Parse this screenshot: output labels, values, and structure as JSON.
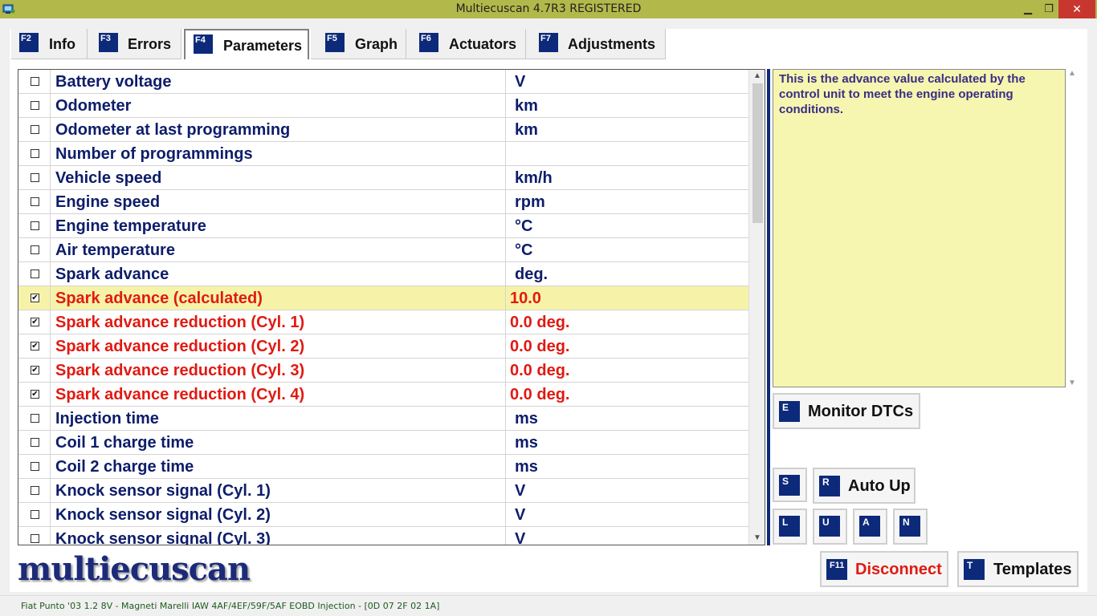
{
  "window": {
    "title": "Multiecuscan 4.7R3 REGISTERED",
    "minimize_glyph": "▁",
    "restore_glyph": "❐",
    "close_glyph": "✕"
  },
  "tabs": [
    {
      "key": "F2",
      "label": "Info"
    },
    {
      "key": "F3",
      "label": "Errors"
    },
    {
      "key": "F4",
      "label": "Parameters",
      "active": true
    },
    {
      "key": "F5",
      "label": "Graph"
    },
    {
      "key": "F6",
      "label": "Actuators"
    },
    {
      "key": "F7",
      "label": "Adjustments"
    }
  ],
  "parameters": [
    {
      "name": "Battery voltage",
      "value": "V",
      "checked": false
    },
    {
      "name": "Odometer",
      "value": "km",
      "checked": false
    },
    {
      "name": "Odometer at last programming",
      "value": "km",
      "checked": false
    },
    {
      "name": "Number of programmings",
      "value": "",
      "checked": false
    },
    {
      "name": "Vehicle speed",
      "value": "km/h",
      "checked": false
    },
    {
      "name": "Engine speed",
      "value": "rpm",
      "checked": false
    },
    {
      "name": "Engine temperature",
      "value": "°C",
      "checked": false
    },
    {
      "name": "Air temperature",
      "value": "°C",
      "checked": false
    },
    {
      "name": "Spark advance",
      "value": "deg.",
      "checked": false
    },
    {
      "name": "Spark advance (calculated)",
      "value": "10.0",
      "checked": true,
      "selected": true
    },
    {
      "name": "Spark advance reduction (Cyl. 1)",
      "value": "0.0 deg.",
      "checked": true
    },
    {
      "name": "Spark advance reduction (Cyl. 2)",
      "value": "0.0 deg.",
      "checked": true
    },
    {
      "name": "Spark advance reduction (Cyl. 3)",
      "value": "0.0 deg.",
      "checked": true
    },
    {
      "name": "Spark advance reduction (Cyl. 4)",
      "value": "0.0 deg.",
      "checked": true
    },
    {
      "name": "Injection time",
      "value": "ms",
      "checked": false
    },
    {
      "name": "Coil 1 charge time",
      "value": "ms",
      "checked": false
    },
    {
      "name": "Coil 2 charge time",
      "value": "ms",
      "checked": false
    },
    {
      "name": "Knock sensor signal (Cyl. 1)",
      "value": "V",
      "checked": false
    },
    {
      "name": "Knock sensor signal (Cyl. 2)",
      "value": "V",
      "checked": false
    },
    {
      "name": "Knock sensor signal (Cyl. 3)",
      "value": "V",
      "checked": false
    }
  ],
  "description": "This is the advance value calculated by the control unit to meet the engine operating conditions.",
  "buttons": {
    "monitor_dtcs": {
      "key": "E",
      "label": "Monitor DTCs"
    },
    "s": {
      "key": "S"
    },
    "auto_up": {
      "key": "R",
      "label": "Auto Up"
    },
    "l": {
      "key": "L"
    },
    "u": {
      "key": "U"
    },
    "a": {
      "key": "A"
    },
    "n": {
      "key": "N"
    },
    "disconnect": {
      "key": "F11",
      "label": "Disconnect"
    },
    "templates": {
      "key": "T",
      "label": "Templates"
    }
  },
  "logo_text": "multiecuscan",
  "status": "Fiat Punto '03 1.2 8V - Magneti Marelli IAW 4AF/4EF/59F/5AF EOBD Injection - [0D 07 2F 02 1A]",
  "colors": {
    "title_bar": "#b3b84a",
    "key_badge": "#0d2a7a",
    "param_text": "#0d1d6a",
    "param_checked": "#e01a12",
    "selected_row": "#f6f3a8",
    "description_bg": "#f6f6b0",
    "disconnect_text": "#e01a12"
  }
}
